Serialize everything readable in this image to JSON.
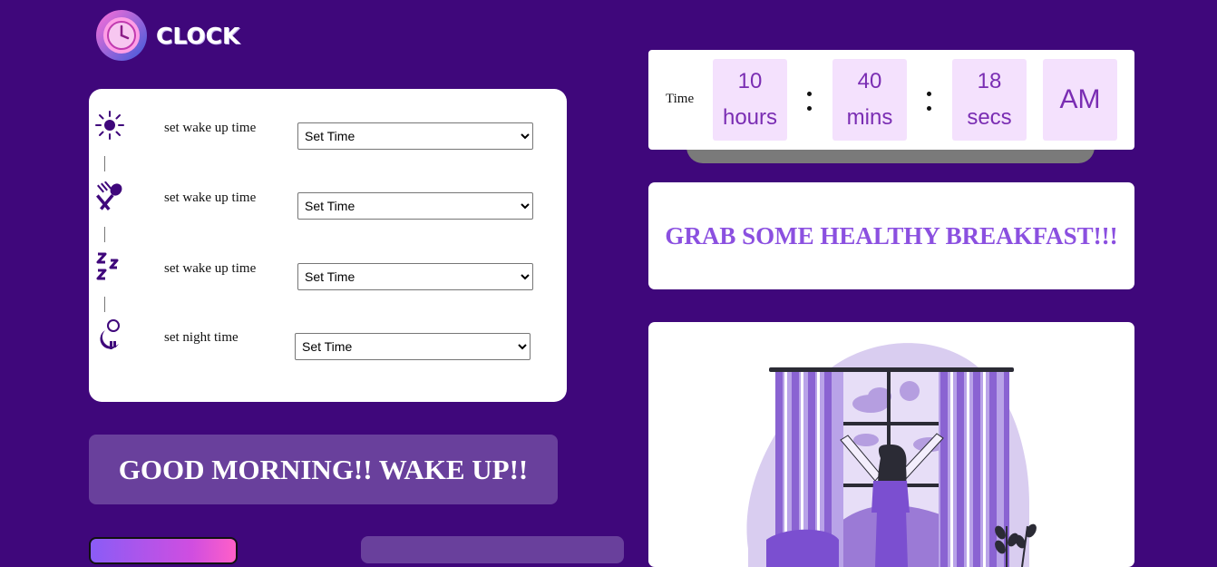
{
  "app": {
    "logo_text": "CLOCK",
    "logo_icon": "clock-icon"
  },
  "schedule": {
    "rows": [
      {
        "icon": "sun-icon",
        "label": "set wake up time",
        "select_value": "Set Time"
      },
      {
        "icon": "utensils-icon",
        "label": "set wake up time",
        "select_value": "Set Time"
      },
      {
        "icon": "sleep-zzz-icon",
        "label": "set wake up time",
        "select_value": "Set Time"
      },
      {
        "icon": "moon-icon",
        "label": "set night time",
        "select_value": "Set Time"
      }
    ]
  },
  "greeting": {
    "text": "GOOD MORNING!! WAKE UP!!"
  },
  "clock": {
    "label": "Time",
    "hours_value": "10",
    "hours_unit": "hours",
    "mins_value": "40",
    "mins_unit": "mins",
    "secs_value": "18",
    "secs_unit": "secs",
    "ampm": "AM"
  },
  "message": {
    "text": "GRAB SOME HEALTHY BREAKFAST!!!"
  },
  "illustration": {
    "name": "woman-opening-curtains-illustration"
  },
  "colors": {
    "background": "#3f077b",
    "accent_purple": "#8b50e0",
    "time_box": "#f4e1fd",
    "greeting_box": "#69409c"
  }
}
